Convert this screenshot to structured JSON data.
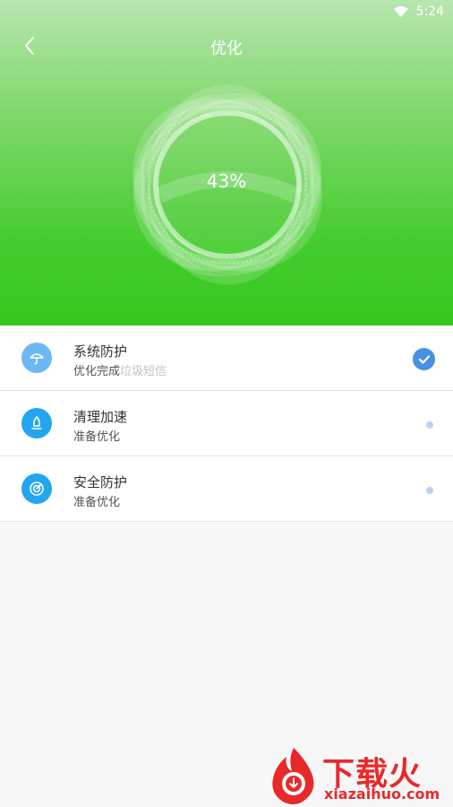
{
  "status_bar": {
    "time": "5:24",
    "wifi_icon": "wifi-icon"
  },
  "header": {
    "title": "优化",
    "back_icon": "chevron-left-icon"
  },
  "progress": {
    "text": "43%",
    "value": 43
  },
  "items": [
    {
      "icon": "umbrella-icon",
      "name": "系统防护",
      "status_done": "优化完成",
      "status_extra": "垃圾短信",
      "state": "done"
    },
    {
      "icon": "rocket-icon",
      "name": "清理加速",
      "status_done": "准备优化",
      "status_extra": "",
      "state": "pending"
    },
    {
      "icon": "shield-icon",
      "name": "安全防护",
      "status_done": "准备优化",
      "status_extra": "",
      "state": "pending"
    }
  ],
  "watermark": {
    "title": "下载火",
    "url": "xiazaihuo.com"
  },
  "colors": {
    "hero_top": "#b8e6b0",
    "hero_bottom": "#36c81f",
    "accent_blue": "#4a90e2",
    "icon_blue": "#22a6f0",
    "watermark_red": "#e8292b"
  }
}
